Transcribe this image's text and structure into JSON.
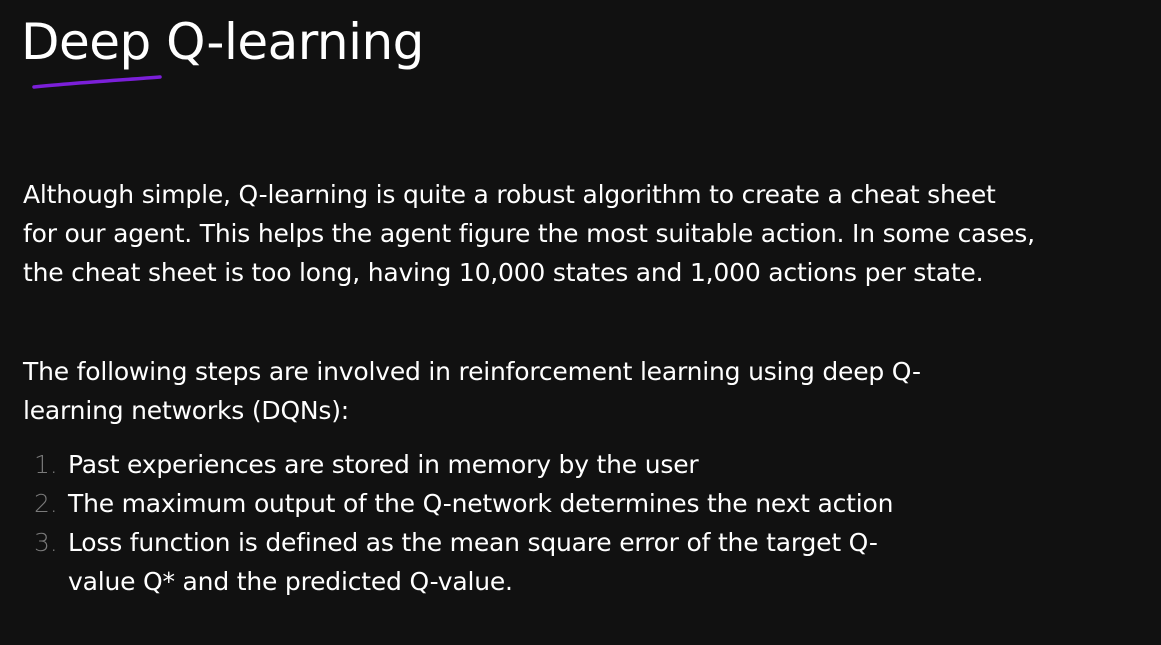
{
  "slide": {
    "title": "Deep Q-learning",
    "accent_color": "#7b1fd9",
    "paragraph1": {
      "line1": "Although simple, Q-learning is quite a robust algorithm to create a cheat sheet",
      "line2": "for our agent. This helps the agent figure the most suitable action. In some cases,",
      "line3": "the cheat sheet is too long, having 10,000 states and 1,000 actions per state."
    },
    "paragraph2": {
      "line1": "The following steps are involved in reinforcement learning using deep Q-",
      "line2": "learning networks (DQNs):"
    },
    "steps": [
      {
        "number": "1.",
        "text": "Past experiences are stored in memory by the user"
      },
      {
        "number": "2.",
        "text": "The maximum output of the Q-network determines the next action"
      },
      {
        "number": "3.",
        "text": "Loss function is defined as the mean square error of the target Q-"
      },
      {
        "number": "",
        "text": "value Q* and the predicted Q-value."
      }
    ]
  }
}
